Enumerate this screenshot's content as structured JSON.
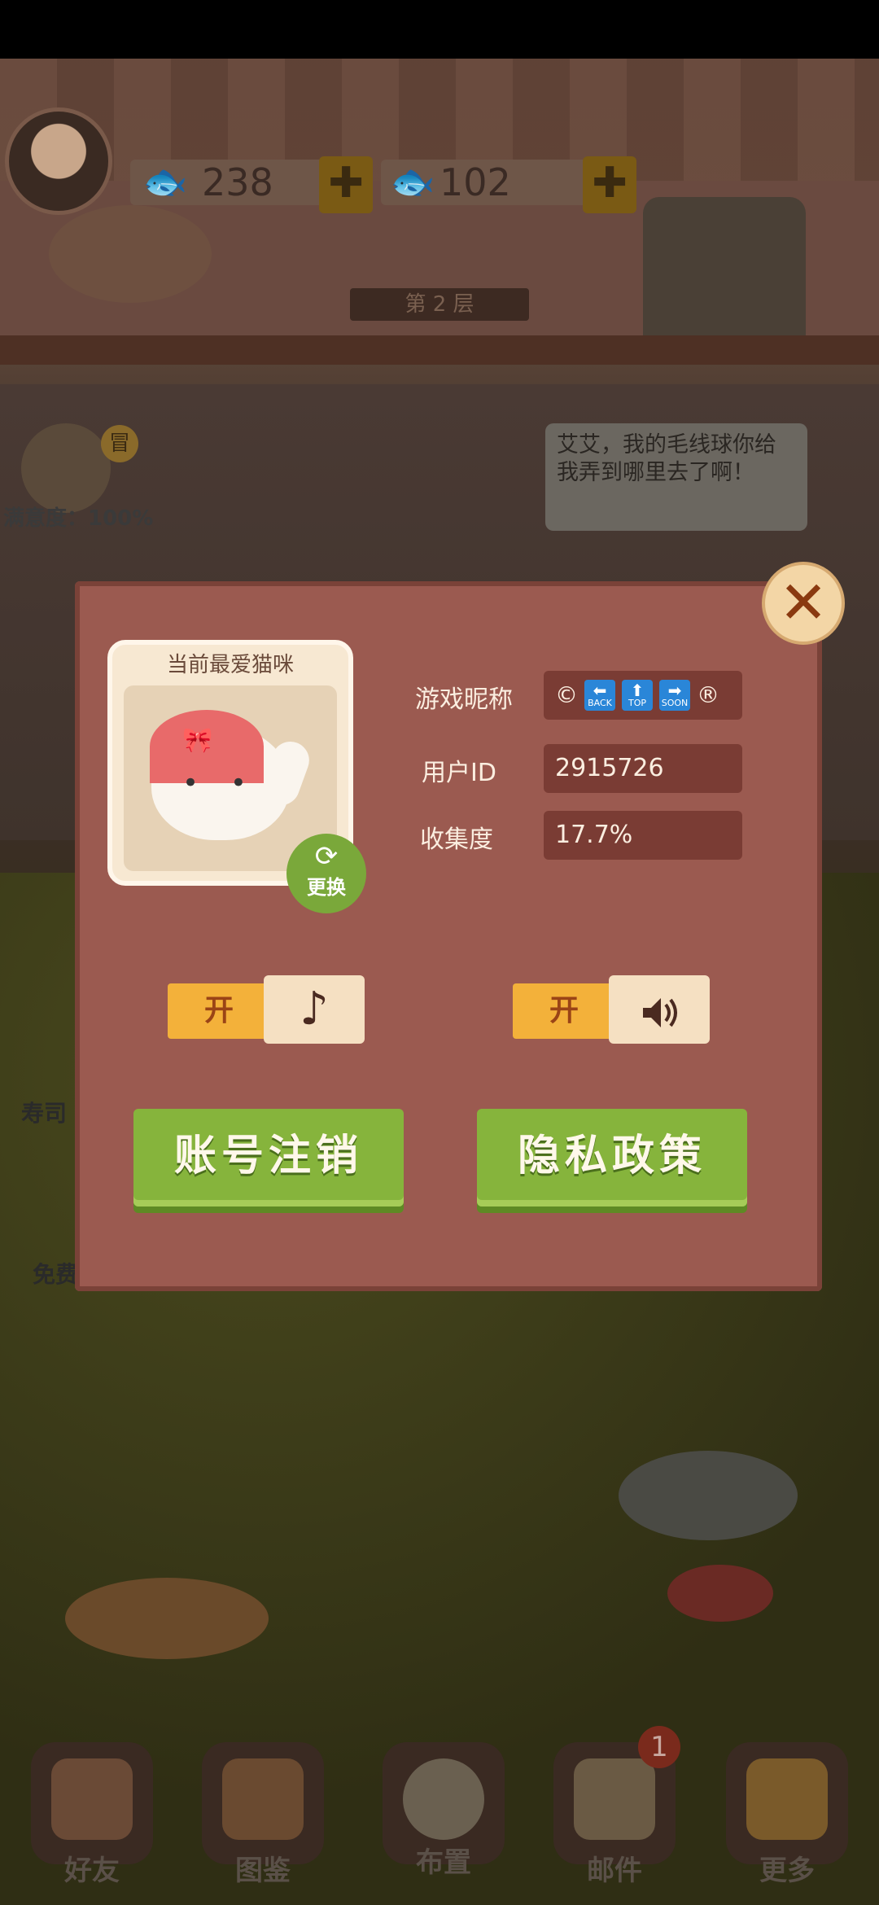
{
  "resources": {
    "fish_count": "238",
    "gold_fish_count": "102",
    "plus": "✚"
  },
  "scene": {
    "floor_label": "第 2 层",
    "speech_bubble": "艾艾，我的毛线球你给我弄到哪里去了啊！",
    "satisfaction": "满意度：100%",
    "npc_badge": "冒",
    "sushi_label": "寿司",
    "free_label": "免费"
  },
  "dialog": {
    "favorite_cat_title": "当前最爱猫咪",
    "swap_label": "更换",
    "close_symbol": "✕",
    "fields": {
      "nickname_label": "游戏昵称",
      "nickname_value": {
        "prefix": "©",
        "icons": [
          {
            "arrow": "⬅",
            "text": "BACK"
          },
          {
            "arrow": "⬆",
            "text": "TOP"
          },
          {
            "arrow": "➡",
            "text": "SOON"
          }
        ],
        "suffix": "®"
      },
      "user_id_label": "用户ID",
      "user_id_value": "2915726",
      "collection_label": "收集度",
      "collection_value": "17.7%"
    },
    "music_toggle": {
      "state": "开",
      "icon": "music-note-icon",
      "glyph": "♪"
    },
    "sound_toggle": {
      "state": "开",
      "icon": "speaker-icon",
      "glyph": "🔊"
    },
    "buttons": {
      "deregister": "账号注销",
      "privacy": "隐私政策"
    }
  },
  "bottom_nav": [
    {
      "label": "好友"
    },
    {
      "label": "图鉴"
    },
    {
      "label": "布置"
    },
    {
      "label": "邮件",
      "badge": "1"
    },
    {
      "label": "更多"
    }
  ],
  "colors": {
    "dialog_bg": "#9b5a50",
    "field_bg": "#7a3c34",
    "toggle_on": "#f3b13a",
    "green_button": "#86b43c"
  }
}
